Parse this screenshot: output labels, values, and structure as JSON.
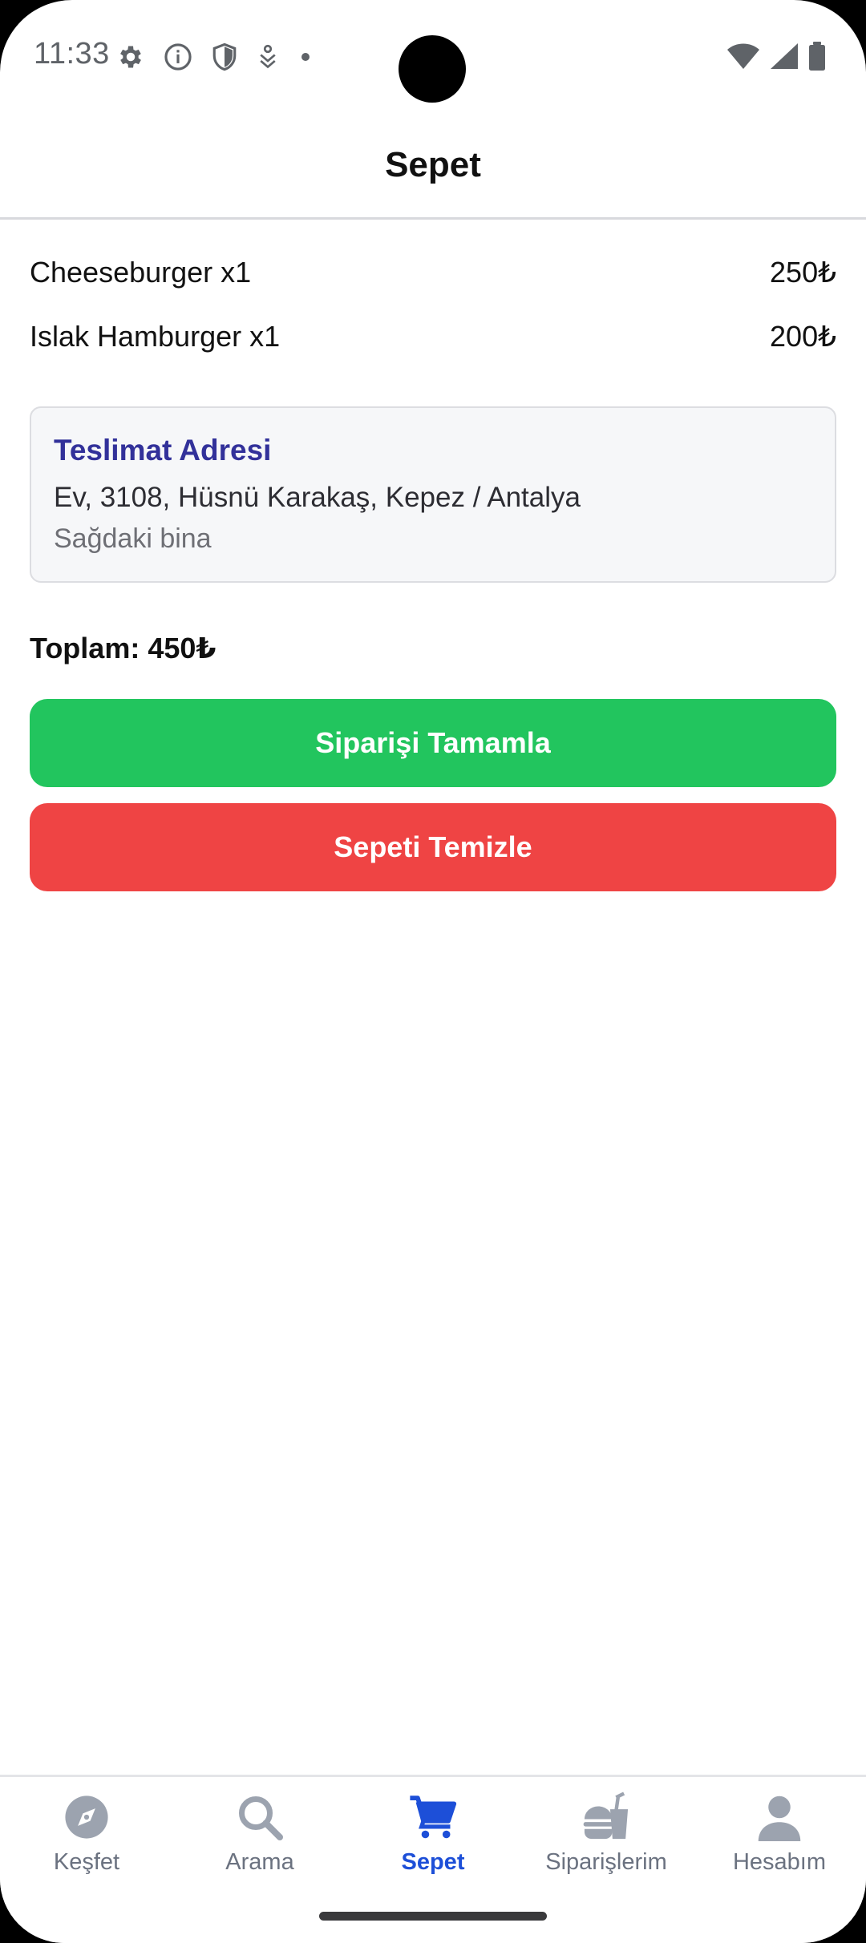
{
  "status_bar": {
    "time": "11:33",
    "left_icons": [
      "gear-icon",
      "info-icon",
      "shield-icon",
      "download-icon",
      "dot-icon"
    ],
    "right_icons": [
      "wifi-icon",
      "signal-icon",
      "battery-icon"
    ]
  },
  "header": {
    "title": "Sepet"
  },
  "cart": {
    "items": [
      {
        "name": "Cheeseburger x1",
        "price": "250₺"
      },
      {
        "name": "Islak Hamburger x1",
        "price": "200₺"
      }
    ]
  },
  "address": {
    "title": "Teslimat Adresi",
    "line": "Ev, 3108, Hüsnü Karakaş, Kepez / Antalya",
    "note": "Sağdaki bina"
  },
  "total": "Toplam: 450₺",
  "buttons": {
    "complete": "Siparişi Tamamla",
    "clear": "Sepeti Temizle"
  },
  "colors": {
    "complete_button": "#22c55e",
    "clear_button": "#ef4444",
    "accent": "#1d4fd8",
    "address_title": "#32319a"
  },
  "nav": {
    "items": [
      {
        "label": "Keşfet",
        "icon": "compass-icon",
        "active": false
      },
      {
        "label": "Arama",
        "icon": "search-icon",
        "active": false
      },
      {
        "label": "Sepet",
        "icon": "cart-icon",
        "active": true
      },
      {
        "label": "Siparişlerim",
        "icon": "food-icon",
        "active": false
      },
      {
        "label": "Hesabım",
        "icon": "person-icon",
        "active": false
      }
    ]
  }
}
